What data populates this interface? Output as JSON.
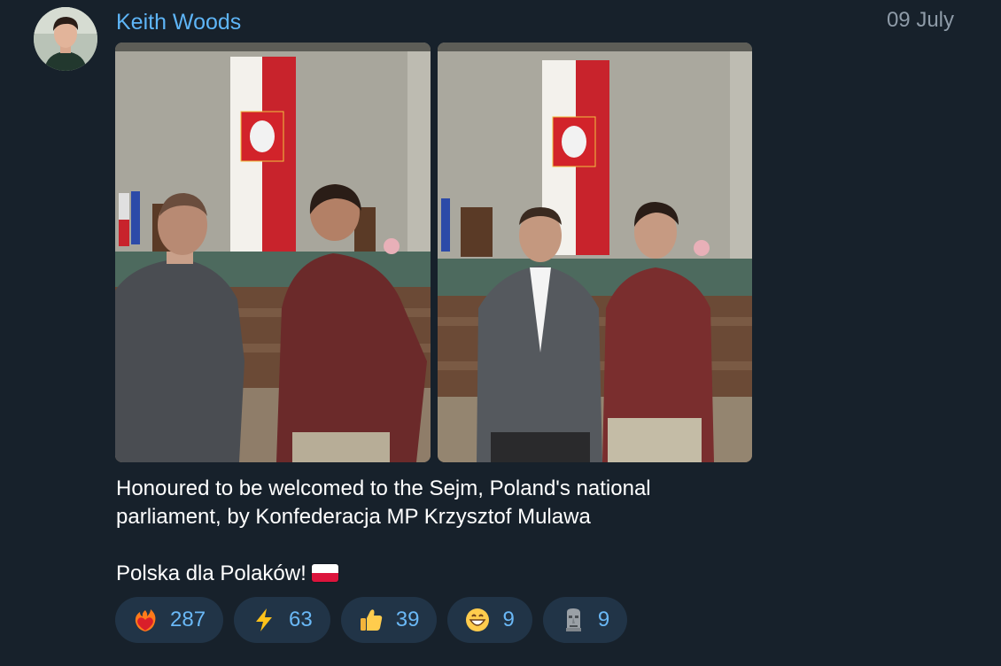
{
  "post": {
    "author": "Keith Woods",
    "date": "09 July",
    "caption_line1": "Honoured to be welcomed to the Sejm, Poland's national",
    "caption_line2": "parliament, by Konfederacja MP Krzysztof Mulawa",
    "caption_line3": "Polska dla Polaków!",
    "flag_icon": "poland-flag-icon"
  },
  "reactions": [
    {
      "icon": "heart-on-fire-icon",
      "count": "287"
    },
    {
      "icon": "lightning-icon",
      "count": "63"
    },
    {
      "icon": "thumbs-up-icon",
      "count": "39"
    },
    {
      "icon": "grinning-face-icon",
      "count": "9"
    },
    {
      "icon": "moai-icon",
      "count": "9"
    }
  ],
  "colors": {
    "background": "#17212b",
    "author": "#5eb5f7",
    "date": "#8e9ba8",
    "reaction_bg": "#213447",
    "reaction_text": "#6ab8f6"
  }
}
